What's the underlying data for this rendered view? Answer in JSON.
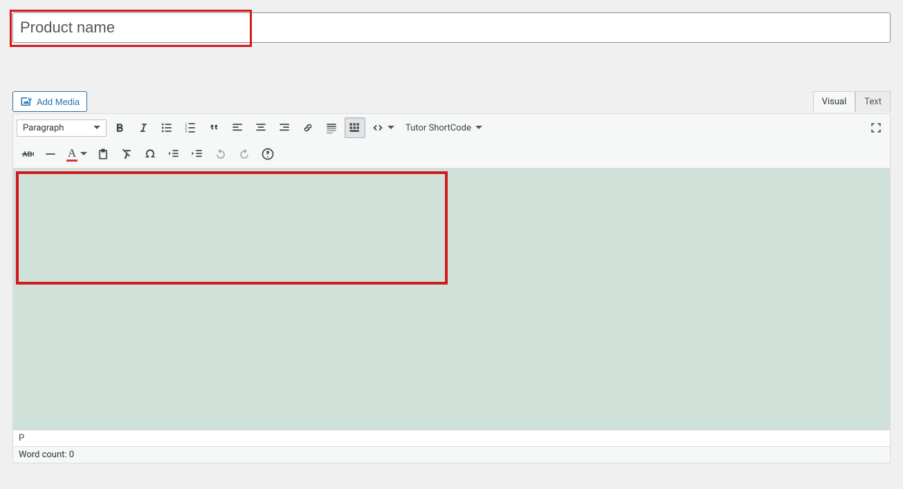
{
  "title": {
    "placeholder": "Product name"
  },
  "mediaButton": {
    "label": "Add Media"
  },
  "tabs": {
    "visual": "Visual",
    "text": "Text"
  },
  "toolbar": {
    "format_label": "Paragraph",
    "shortcode_label": "Tutor ShortCode"
  },
  "pathRow": "P",
  "wordCount": "Word count: 0"
}
